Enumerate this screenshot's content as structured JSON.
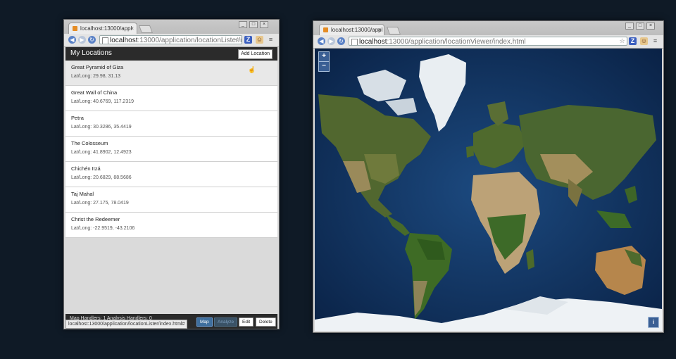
{
  "left_window": {
    "tab_title": "localhost:13000/appl",
    "tab_close": "×",
    "url_host": "localhost",
    "url_path": ":13000/application/locationLister/ir",
    "app": {
      "title": "My Locations",
      "add_button": "Add Location",
      "items": [
        {
          "name": "Great Pyramid of Giza",
          "coords": "Lat/Long: 29.98, 31.13"
        },
        {
          "name": "Great Wall of China",
          "coords": "Lat/Long: 40.6769, 117.2319"
        },
        {
          "name": "Petra",
          "coords": "Lat/Long: 30.3286, 35.4419"
        },
        {
          "name": "The Colosseum",
          "coords": "Lat/Long: 41.8902, 12.4923"
        },
        {
          "name": "Chichén Itzá",
          "coords": "Lat/Long: 20.6829, 88.5686"
        },
        {
          "name": "Taj Mahal",
          "coords": "Lat/Long: 27.175, 78.0419"
        },
        {
          "name": "Christ the Redeemer",
          "coords": "Lat/Long: -22.9519, -43.2106"
        }
      ],
      "footer_text": "Map Handlers: 1 Analysis Handlers: 0",
      "status_url": "localhost:13000/application/locationLister/index.html#",
      "buttons": {
        "map": "Map",
        "analyze": "Analyze",
        "edit": "Edit",
        "delete": "Delete"
      }
    }
  },
  "right_window": {
    "tab_title": "localhost:13000/appl",
    "tab_close": "×",
    "url_host": "localhost",
    "url_path": ":13000/application/locationViewer/index.html",
    "zoom_in": "+",
    "zoom_out": "−",
    "info": "i"
  },
  "icons": {
    "z_extension": "Z",
    "face_extension": "☺",
    "menu": "≡",
    "star": "☆",
    "back": "◀",
    "forward": "▶",
    "reload": "↻"
  },
  "colors": {
    "desktop": "#0f1a26",
    "appbar": "#2b2b2b",
    "map_button": "#3f6f9e",
    "ocean": "#0c2a52"
  }
}
